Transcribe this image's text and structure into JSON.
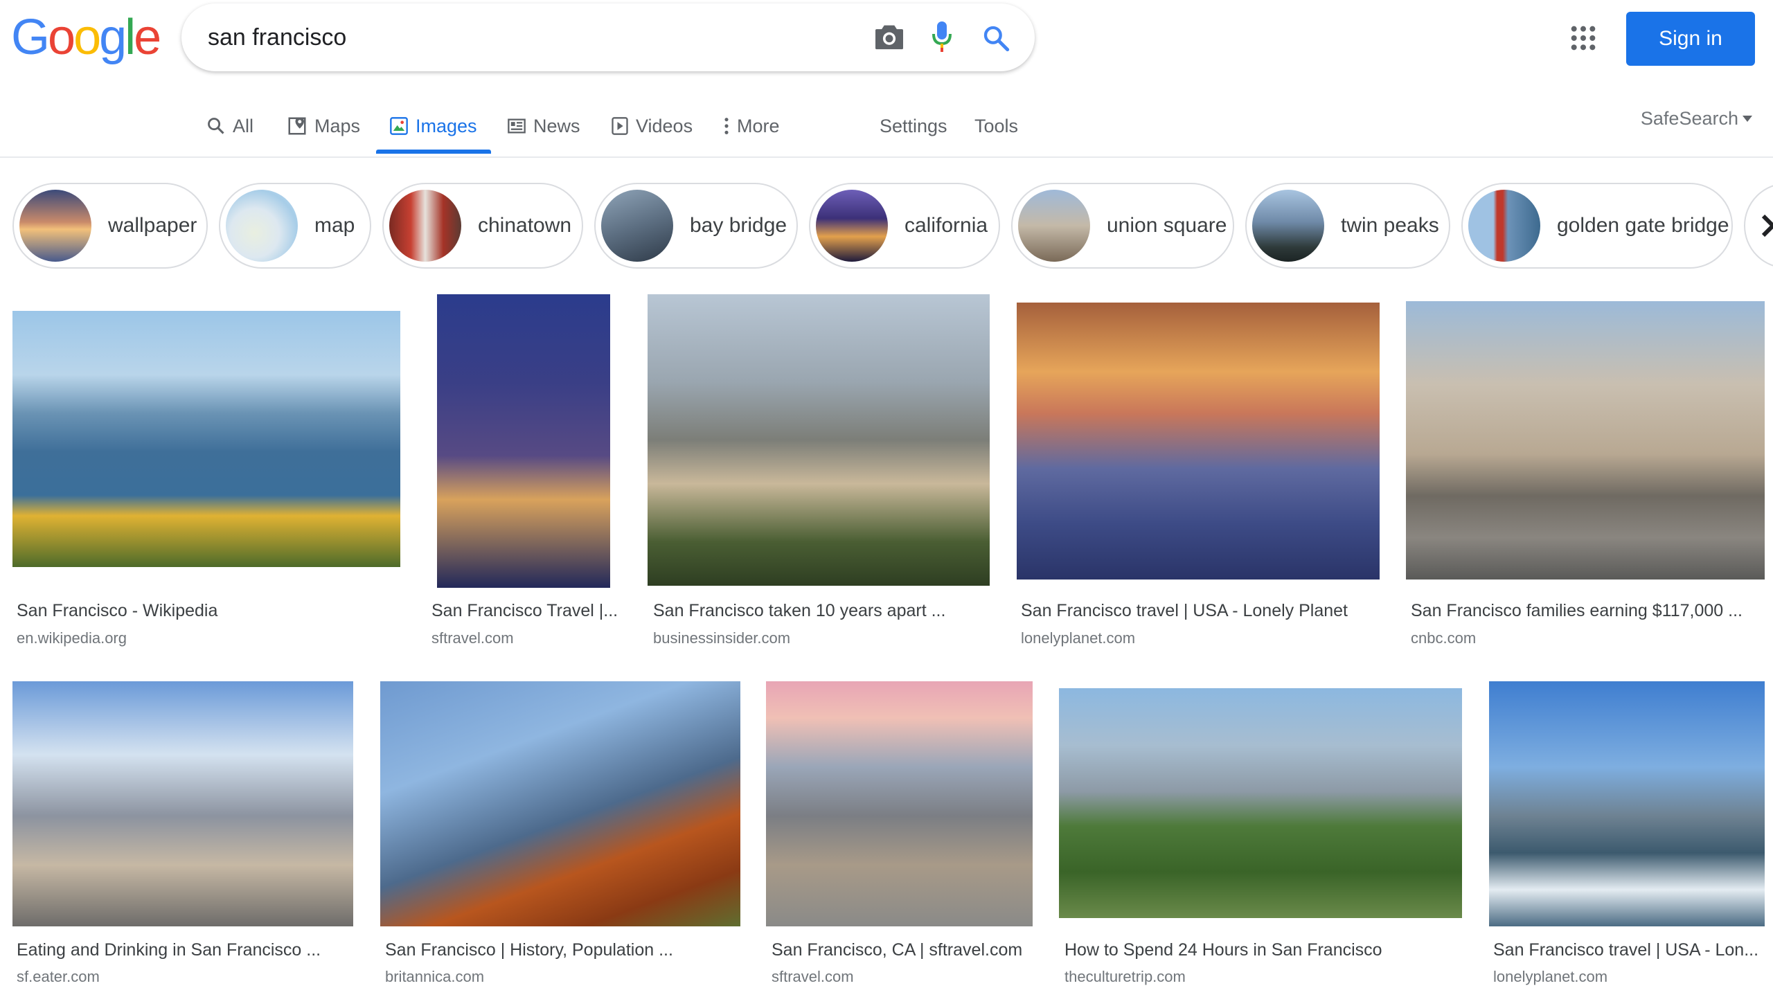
{
  "header": {
    "logo_letters": [
      "G",
      "o",
      "o",
      "g",
      "l",
      "e"
    ],
    "logo_colors": [
      "#4285f4",
      "#ea4335",
      "#fbbc05",
      "#4285f4",
      "#34a853",
      "#ea4335"
    ],
    "query": "san francisco",
    "sign_in_label": "Sign in"
  },
  "nav": {
    "tabs": [
      {
        "label": "All",
        "icon": "search-icon"
      },
      {
        "label": "Maps",
        "icon": "map-pin-icon"
      },
      {
        "label": "Images",
        "icon": "image-icon",
        "active": true
      },
      {
        "label": "News",
        "icon": "news-icon"
      },
      {
        "label": "Videos",
        "icon": "play-icon"
      },
      {
        "label": "More",
        "icon": "more-vertical-icon"
      }
    ],
    "settings_label": "Settings",
    "tools_label": "Tools",
    "safesearch_label": "SafeSearch"
  },
  "chips": [
    {
      "label": "wallpaper"
    },
    {
      "label": "map"
    },
    {
      "label": "chinatown"
    },
    {
      "label": "bay bridge"
    },
    {
      "label": "california"
    },
    {
      "label": "union square"
    },
    {
      "label": "twin peaks"
    },
    {
      "label": "golden gate bridge"
    }
  ],
  "results": [
    {
      "title": "San Francisco - Wikipedia",
      "source": "en.wikipedia.org"
    },
    {
      "title": "San Francisco Travel |...",
      "source": "sftravel.com"
    },
    {
      "title": "San Francisco taken 10 years apart ...",
      "source": "businessinsider.com"
    },
    {
      "title": "San Francisco travel | USA - Lonely Planet",
      "source": "lonelyplanet.com"
    },
    {
      "title": "San Francisco families earning $117,000 ...",
      "source": "cnbc.com"
    },
    {
      "title": "Eating and Drinking in San Francisco ...",
      "source": "sf.eater.com"
    },
    {
      "title": "San Francisco | History, Population ...",
      "source": "britannica.com"
    },
    {
      "title": "San Francisco, CA | sftravel.com",
      "source": "sftravel.com"
    },
    {
      "title": "How to Spend 24 Hours in San Francisco",
      "source": "theculturetrip.com"
    },
    {
      "title": "San Francisco travel | USA - Lon...",
      "source": "lonelyplanet.com"
    }
  ],
  "colors": {
    "accent": "#1a73e8",
    "text_secondary": "#70757a",
    "border": "#dadce0"
  }
}
